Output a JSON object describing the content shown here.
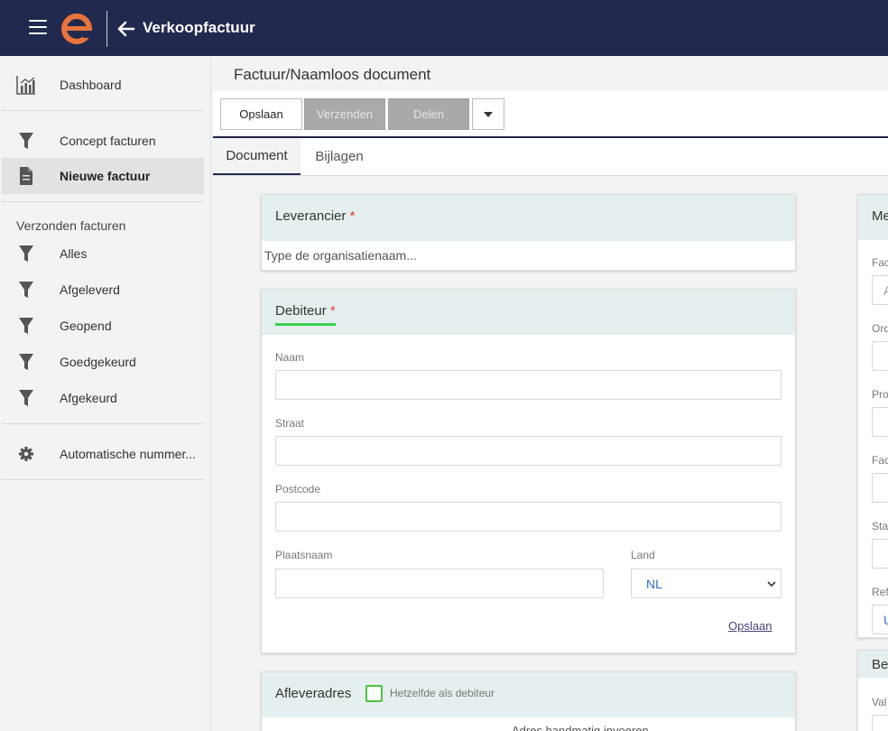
{
  "header": {
    "title": "Verkoopfactuur",
    "colors": {
      "bar": "#212a4e",
      "logo": "#e8743b"
    }
  },
  "sidebar": {
    "items_top": [
      {
        "label": "Dashboard",
        "icon": "chart-icon"
      }
    ],
    "items_concept": [
      {
        "label": "Concept facturen",
        "icon": "filter-icon"
      },
      {
        "label": "Nieuwe factuur",
        "icon": "document-icon",
        "active": true
      }
    ],
    "sent_heading": "Verzonden facturen",
    "items_sent": [
      {
        "label": "Alles",
        "icon": "filter-icon"
      },
      {
        "label": "Afgeleverd",
        "icon": "filter-icon"
      },
      {
        "label": "Geopend",
        "icon": "filter-icon"
      },
      {
        "label": "Goedgekeurd",
        "icon": "filter-icon"
      },
      {
        "label": "Afgekeurd",
        "icon": "filter-icon"
      }
    ],
    "items_settings": [
      {
        "label": "Automatische nummer...",
        "icon": "gear-icon"
      }
    ]
  },
  "main": {
    "title": "Factuur/Naamloos document",
    "toolbar": {
      "save": "Opslaan",
      "send": "Verzenden",
      "share": "Delen"
    },
    "tabs": [
      {
        "label": "Document",
        "active": true
      },
      {
        "label": "Bijlagen"
      }
    ]
  },
  "leverancier": {
    "title": "Leverancier",
    "required": "*",
    "placeholder": "Type de organisatienaam..."
  },
  "debiteur": {
    "title": "Debiteur",
    "required": "*",
    "fields": {
      "naam": "Naam",
      "straat": "Straat",
      "postcode": "Postcode",
      "plaatsnaam": "Plaatsnaam",
      "land": "Land"
    },
    "land_value": "NL",
    "save_link": "Opslaan"
  },
  "afleveradres": {
    "title": "Afleveradres",
    "checkbox_label": "Hetzelfde als debiteur",
    "manual_link": "Adres handmatig invoeren"
  },
  "right_panel": {
    "head1": "Me",
    "labels": [
      "Fac",
      "Ord",
      "Pro",
      "Fac",
      "Sta",
      "Ref",
      "Val"
    ],
    "values": [
      "A",
      "U"
    ],
    "head2": "Be"
  }
}
